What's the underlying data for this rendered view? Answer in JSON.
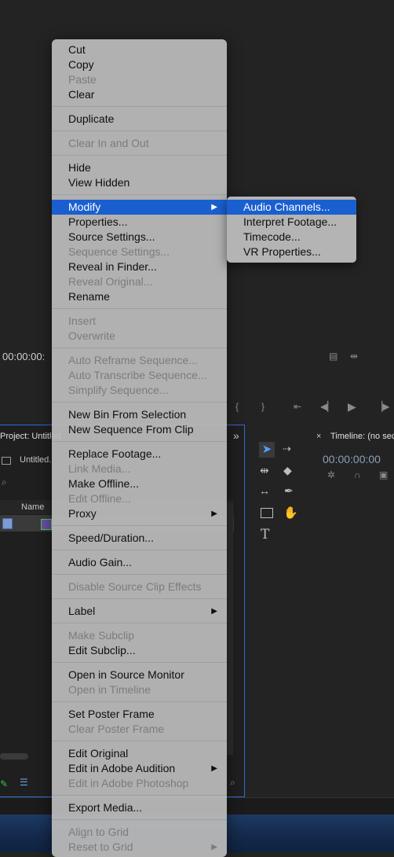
{
  "background": {
    "source_timecode": "00:00:00:",
    "project_tab": "Project: Untitled",
    "project_file": "Untitled.",
    "name_column": "Name",
    "timeline_tab": "Timeline: (no sec",
    "timeline_timecode": "00:00:00:00",
    "close_glyph": "×",
    "overflow_glyph": "»"
  },
  "menu": {
    "items": [
      {
        "label": "Cut",
        "disabled": false
      },
      {
        "label": "Copy",
        "disabled": false
      },
      {
        "label": "Paste",
        "disabled": true
      },
      {
        "label": "Clear",
        "disabled": false
      },
      {
        "separator": true
      },
      {
        "label": "Duplicate",
        "disabled": false
      },
      {
        "separator": true
      },
      {
        "label": "Clear In and Out",
        "disabled": true
      },
      {
        "separator": true
      },
      {
        "label": "Hide",
        "disabled": false
      },
      {
        "label": "View Hidden",
        "disabled": false
      },
      {
        "separator": true
      },
      {
        "label": "Modify",
        "disabled": false,
        "submenu": true,
        "highlighted": true
      },
      {
        "label": "Properties...",
        "disabled": false
      },
      {
        "label": "Source Settings...",
        "disabled": false
      },
      {
        "label": "Sequence Settings...",
        "disabled": true
      },
      {
        "label": "Reveal in Finder...",
        "disabled": false
      },
      {
        "label": "Reveal Original...",
        "disabled": true
      },
      {
        "label": "Rename",
        "disabled": false
      },
      {
        "separator": true
      },
      {
        "label": "Insert",
        "disabled": true
      },
      {
        "label": "Overwrite",
        "disabled": true
      },
      {
        "separator": true
      },
      {
        "label": "Auto Reframe Sequence...",
        "disabled": true
      },
      {
        "label": "Auto Transcribe Sequence...",
        "disabled": true
      },
      {
        "label": "Simplify Sequence...",
        "disabled": true
      },
      {
        "separator": true
      },
      {
        "label": "New Bin From Selection",
        "disabled": false
      },
      {
        "label": "New Sequence From Clip",
        "disabled": false
      },
      {
        "separator": true
      },
      {
        "label": "Replace Footage...",
        "disabled": false
      },
      {
        "label": "Link Media...",
        "disabled": true
      },
      {
        "label": "Make Offline...",
        "disabled": false
      },
      {
        "label": "Edit Offline...",
        "disabled": true
      },
      {
        "label": "Proxy",
        "disabled": false,
        "submenu": true
      },
      {
        "separator": true
      },
      {
        "label": "Speed/Duration...",
        "disabled": false
      },
      {
        "separator": true
      },
      {
        "label": "Audio Gain...",
        "disabled": false
      },
      {
        "separator": true
      },
      {
        "label": "Disable Source Clip Effects",
        "disabled": true
      },
      {
        "separator": true
      },
      {
        "label": "Label",
        "disabled": false,
        "submenu": true
      },
      {
        "separator": true
      },
      {
        "label": "Make Subclip",
        "disabled": true
      },
      {
        "label": "Edit Subclip...",
        "disabled": false
      },
      {
        "separator": true
      },
      {
        "label": "Open in Source Monitor",
        "disabled": false
      },
      {
        "label": "Open in Timeline",
        "disabled": true
      },
      {
        "separator": true
      },
      {
        "label": "Set Poster Frame",
        "disabled": false
      },
      {
        "label": "Clear Poster Frame",
        "disabled": true
      },
      {
        "separator": true
      },
      {
        "label": "Edit Original",
        "disabled": false
      },
      {
        "label": "Edit in Adobe Audition",
        "disabled": false,
        "submenu": true
      },
      {
        "label": "Edit in Adobe Photoshop",
        "disabled": true
      },
      {
        "separator": true
      },
      {
        "label": "Export Media...",
        "disabled": false
      },
      {
        "separator": true
      },
      {
        "label": "Align to Grid",
        "disabled": true
      },
      {
        "label": "Reset to Grid",
        "disabled": true,
        "submenu": true
      }
    ],
    "submenu_arrow": "▶"
  },
  "submenu": {
    "items": [
      {
        "label": "Audio Channels...",
        "highlighted": true
      },
      {
        "label": "Interpret Footage..."
      },
      {
        "label": "Timecode..."
      },
      {
        "label": "VR Properties..."
      }
    ]
  },
  "colors": {
    "highlight": "#1a5fd0",
    "menu_bg": "#bababa",
    "panel_border": "#2d6ed0",
    "app_bg": "#232323"
  }
}
